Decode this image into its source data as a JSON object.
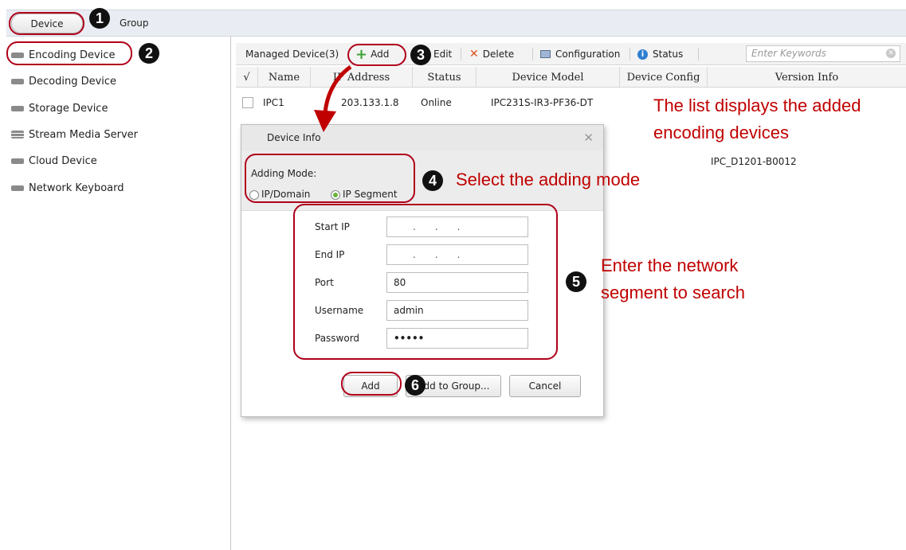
{
  "top_tabs": {
    "device": "Device",
    "group": "Group"
  },
  "sidebar": {
    "items": [
      {
        "label": "Encoding Device"
      },
      {
        "label": "Decoding Device"
      },
      {
        "label": "Storage Device"
      },
      {
        "label": "Stream Media Server"
      },
      {
        "label": "Cloud Device"
      },
      {
        "label": "Network Keyboard"
      }
    ]
  },
  "toolbar": {
    "managed_count": "Managed Device(3)",
    "add": "Add",
    "edit": "Edit",
    "delete": "Delete",
    "configuration": "Configuration",
    "status": "Status",
    "search_placeholder": "Enter Keywords"
  },
  "table": {
    "columns": [
      "√",
      "Name",
      "IP Address",
      "Status",
      "Device Model",
      "Device Config",
      "Version Info"
    ],
    "rows": [
      {
        "name": "IPC1",
        "ip": "203.133.1.8",
        "status": "Online",
        "model": "IPC231S-IR3-PF36-DT",
        "config": "",
        "version": ""
      }
    ],
    "partial_version": "IPC_D1201-B0012"
  },
  "dialog": {
    "title": "Device Info",
    "adding_mode_label": "Adding Mode:",
    "mode_ip_domain": "IP/Domain",
    "mode_ip_segment": "IP Segment",
    "fields": {
      "start_ip_label": "Start IP",
      "end_ip_label": "End IP",
      "port_label": "Port",
      "port_value": "80",
      "username_label": "Username",
      "username_value": "admin",
      "password_label": "Password",
      "password_value": "•••••"
    },
    "buttons": {
      "add": "Add",
      "add_to_group": "Add to Group...",
      "cancel": "Cancel"
    }
  },
  "annotations": {
    "list_note_line1": "The list displays the added",
    "list_note_line2": "encoding devices",
    "mode_note": "Select the adding mode",
    "segment_note_line1": "Enter the network",
    "segment_note_line2": "segment to search",
    "badges": [
      "1",
      "2",
      "3",
      "4",
      "5",
      "6"
    ]
  },
  "colors": {
    "annotation": "#c00000",
    "highlight_ring": "#b0001a",
    "add_plus": "#3aa335",
    "delete_x": "#e0501e",
    "status_info": "#2f7fd1"
  }
}
